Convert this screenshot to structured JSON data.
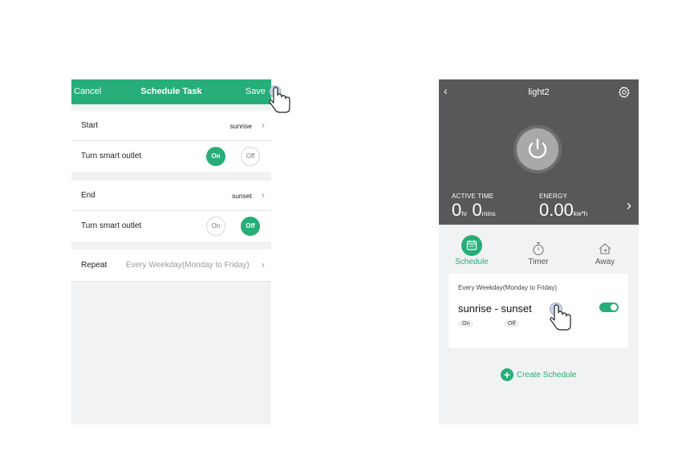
{
  "left": {
    "nav": {
      "cancel": "Cancel",
      "title": "Schedule Task",
      "save": "Save"
    },
    "start": {
      "label": "Start",
      "value": "sunrise"
    },
    "start_outlet": {
      "label": "Turn smart outlet",
      "on": "On",
      "off": "Off",
      "selected": "On"
    },
    "end": {
      "label": "End",
      "value": "sunset"
    },
    "end_outlet": {
      "label": "Turn smart outlet",
      "on": "On",
      "off": "Off",
      "selected": "Off"
    },
    "repeat": {
      "label": "Repeat",
      "value": "Every Weekday(Monday to Friday)"
    }
  },
  "right": {
    "header": {
      "device": "light2"
    },
    "stats": {
      "active_label": "ACTIVE TIME",
      "hr": "0",
      "hr_unit": "hr",
      "mins": "0",
      "mins_unit": "mins",
      "energy_label": "ENERGY",
      "energy": "0.00",
      "energy_unit": "kw*h"
    },
    "tabs": [
      {
        "label": "Schedule",
        "icon": "calendar-icon",
        "active": true
      },
      {
        "label": "Timer",
        "icon": "stopwatch-icon",
        "active": false
      },
      {
        "label": "Away",
        "icon": "away-home-icon",
        "active": false
      }
    ],
    "schedule": {
      "repeat": "Every Weekday(Monday to Friday)",
      "range": "sunrise - sunset",
      "start_state": "On",
      "end_state": "Off",
      "enabled": true
    },
    "create": "Create Schedule"
  },
  "colors": {
    "accent": "#27ae78",
    "dark_panel": "#58585a",
    "page_bg": "#f1f2f4"
  }
}
